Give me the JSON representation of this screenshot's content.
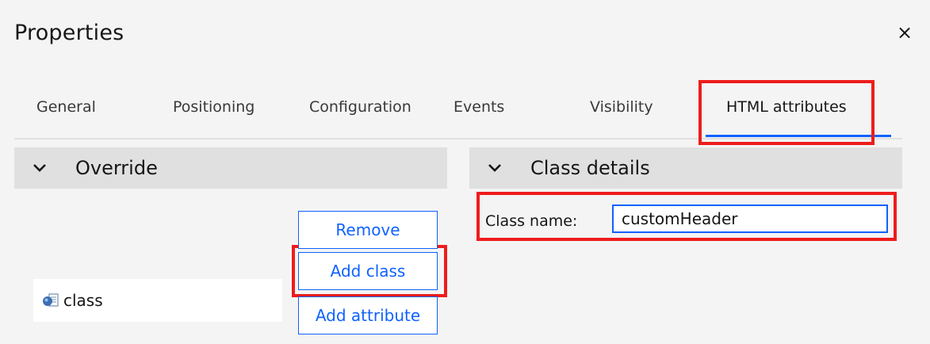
{
  "dialog": {
    "title": "Properties",
    "close_glyph": "×"
  },
  "tabs": [
    {
      "label": "General"
    },
    {
      "label": "Positioning"
    },
    {
      "label": "Configuration"
    },
    {
      "label": "Events"
    },
    {
      "label": "Visibility"
    },
    {
      "label": "HTML attributes",
      "active": true
    }
  ],
  "override": {
    "header": "Override",
    "list_items": [
      {
        "label": "class",
        "icon": "class-attribute-icon"
      }
    ],
    "buttons": {
      "remove": "Remove",
      "add_class": "Add class",
      "add_attribute": "Add attribute"
    }
  },
  "class_details": {
    "header": "Class details",
    "class_name_label": "Class name:",
    "class_name_value": "customHeader"
  },
  "colors": {
    "accent": "#0f62fe",
    "highlight": "#ee1c1c",
    "section_bg": "#e0e0e0"
  }
}
